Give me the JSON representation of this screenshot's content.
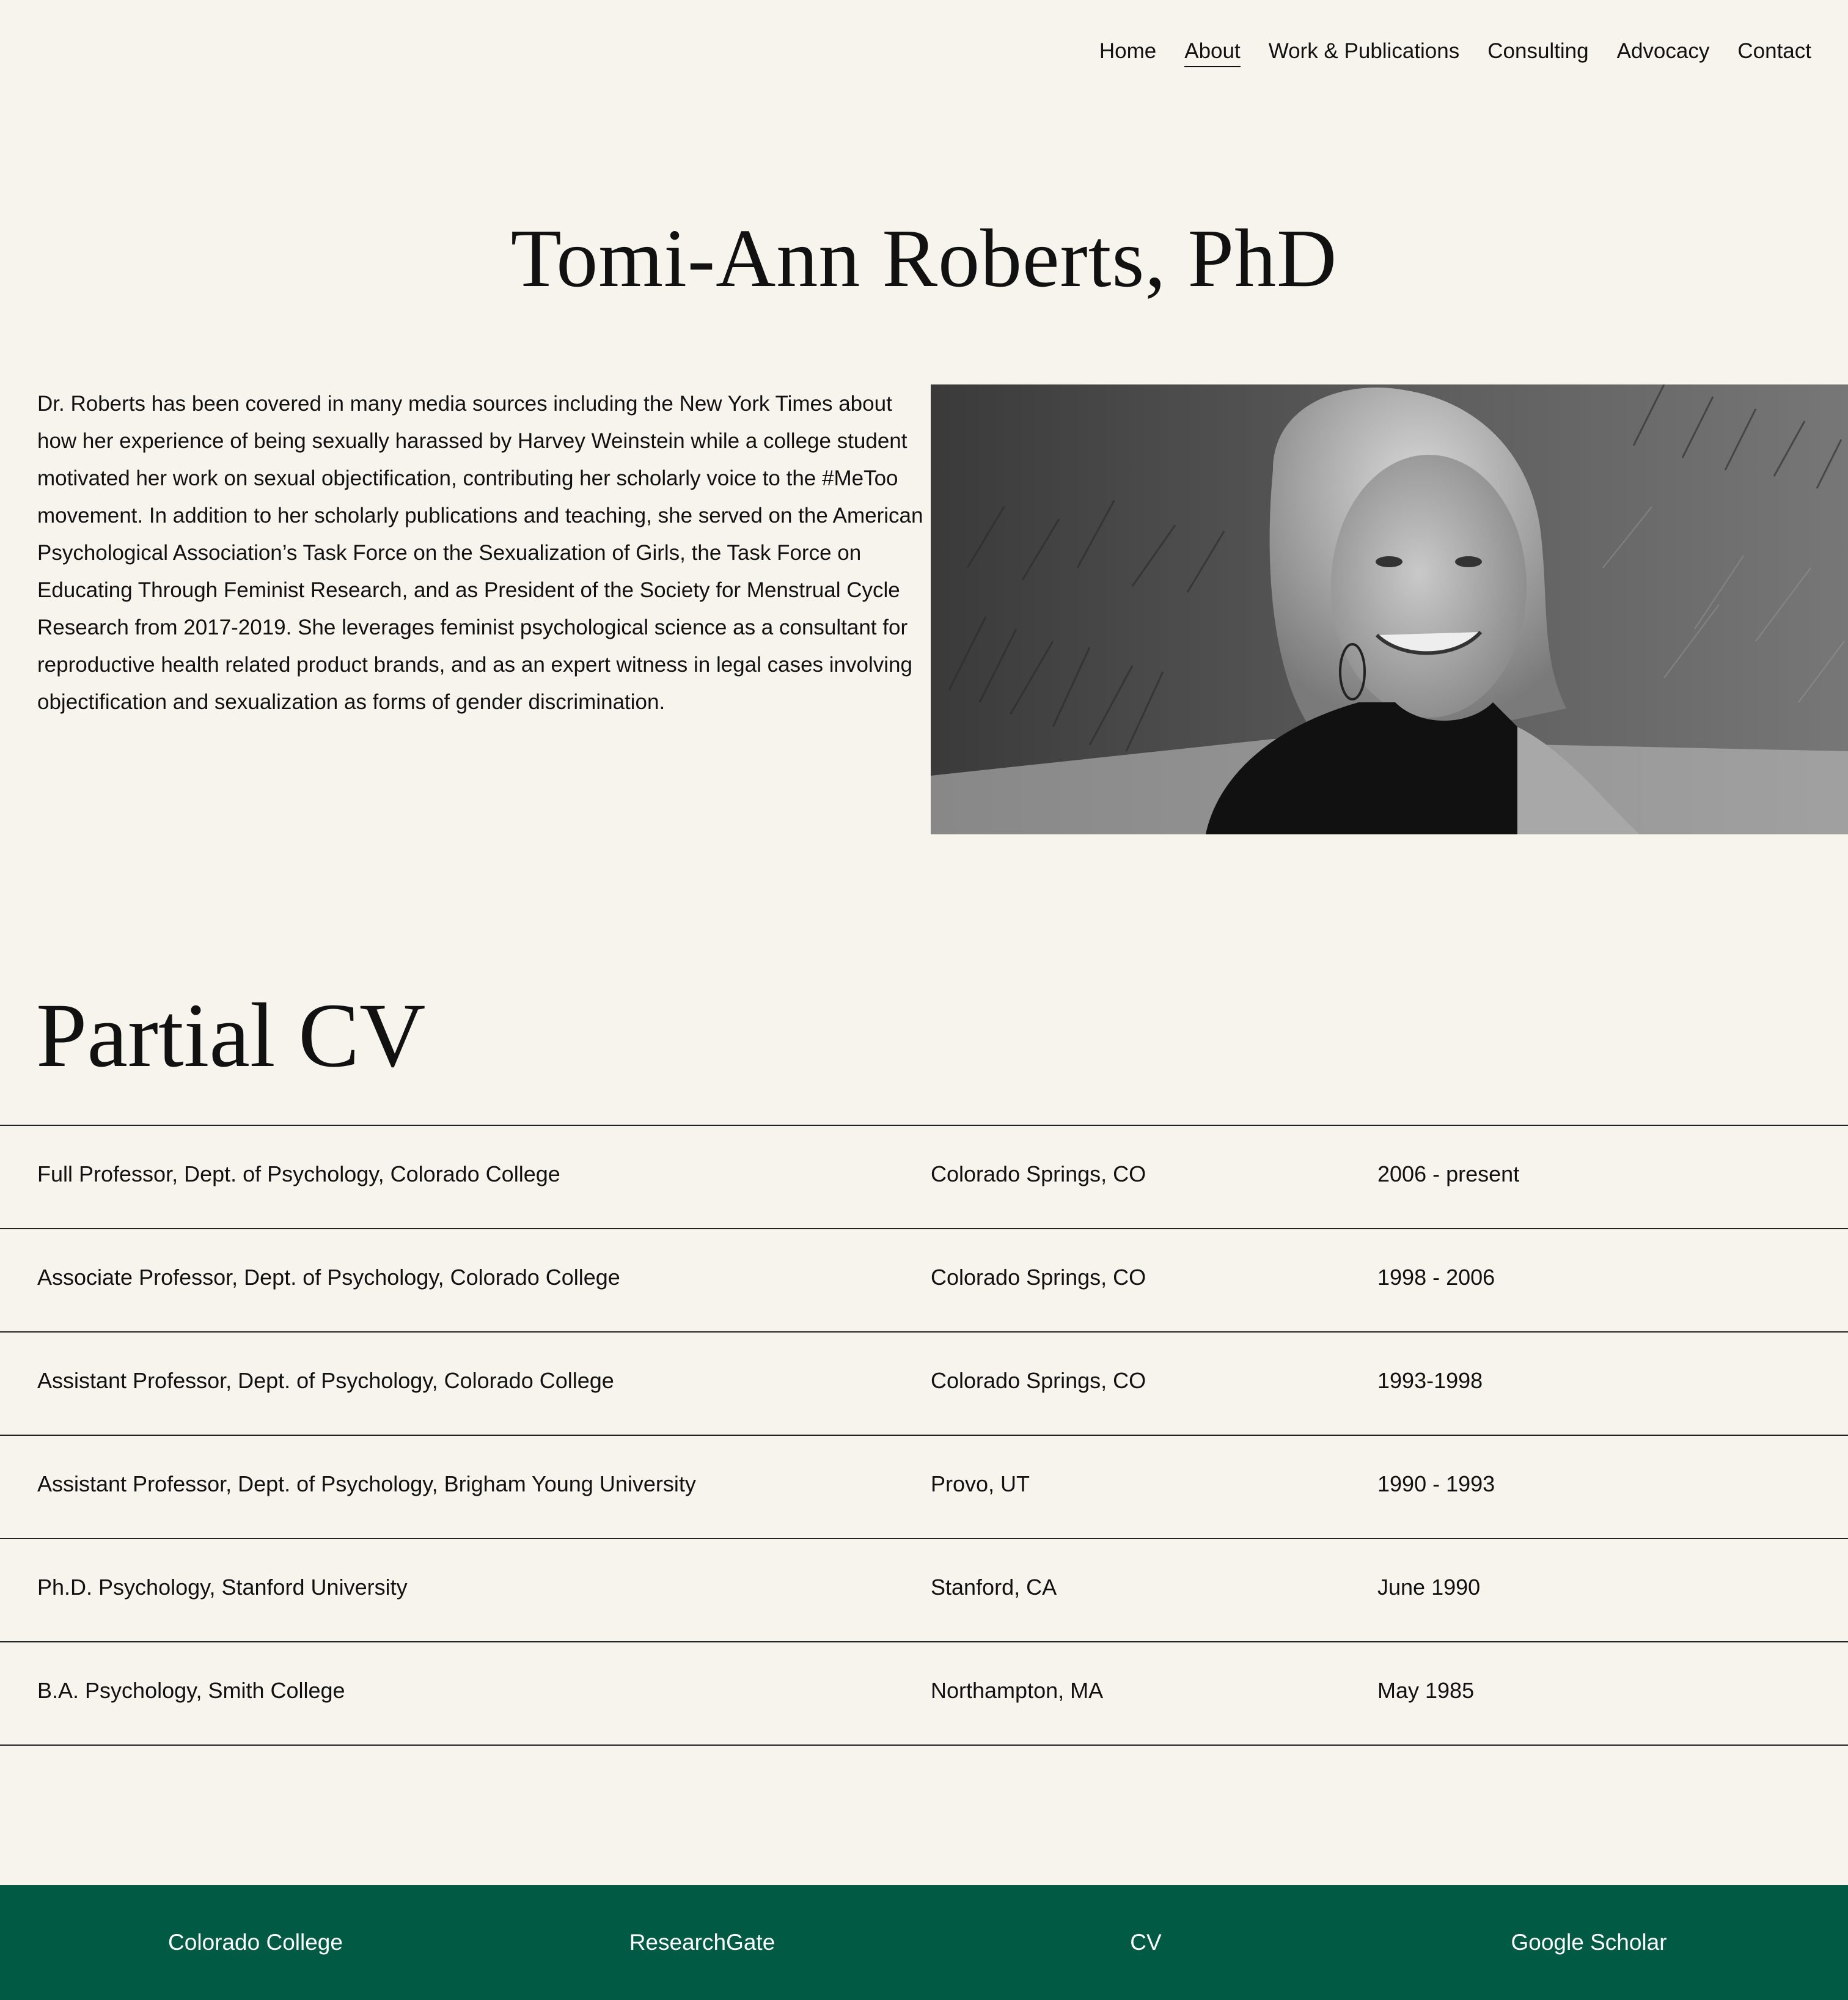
{
  "nav": {
    "items": [
      {
        "label": "Home"
      },
      {
        "label": "About"
      },
      {
        "label": "Work & Publications"
      },
      {
        "label": "Consulting"
      },
      {
        "label": "Advocacy"
      },
      {
        "label": "Contact"
      }
    ],
    "active": "About"
  },
  "header": {
    "title": "Tomi-Ann Roberts, PhD"
  },
  "bio": {
    "text": "Dr. Roberts has been covered in many media sources including the New York Times about how her experience of being sexually harassed by Harvey Weinstein while a college student motivated her work on sexual objectification, contributing her scholarly voice to the #MeToo movement. In addition to her scholarly publications and teaching, she served on the American Psychological Association’s Task Force on the Sexualization of Girls, the Task Force on Educating Through Feminist Research, and as President of the Society for Menstrual Cycle Research from 2017-2019. She leverages feminist psychological science as a consultant for reproductive health related product brands, and as an expert witness in legal cases involving objectification and sexualization as forms of gender discrimination."
  },
  "cv": {
    "heading": "Partial CV",
    "rows": [
      {
        "title": "Full Professor, Dept. of Psychology, Colorado College",
        "location": "Colorado Springs, CO",
        "dates": "2006 - present"
      },
      {
        "title": "Associate Professor, Dept. of Psychology, Colorado College",
        "location": "Colorado Springs, CO",
        "dates": "1998 - 2006"
      },
      {
        "title": "Assistant Professor, Dept. of Psychology, Colorado College",
        "location": "Colorado Springs, CO",
        "dates": "1993-1998"
      },
      {
        "title": "Assistant Professor, Dept. of Psychology, Brigham Young University",
        "location": "Provo, UT",
        "dates": "1990 - 1993"
      },
      {
        "title": "Ph.D. Psychology, Stanford University",
        "location": "Stanford, CA",
        "dates": "June 1990"
      },
      {
        "title": "B.A. Psychology, Smith College",
        "location": "Northampton, MA",
        "dates": "May 1985"
      }
    ]
  },
  "footer": {
    "links": [
      {
        "label": "Colorado College"
      },
      {
        "label": "ResearchGate"
      },
      {
        "label": "CV"
      },
      {
        "label": "Google Scholar"
      }
    ]
  },
  "colors": {
    "background": "#f6f4ec",
    "text": "#111111",
    "footer": "#005a44",
    "footer_text": "#ffffff"
  }
}
